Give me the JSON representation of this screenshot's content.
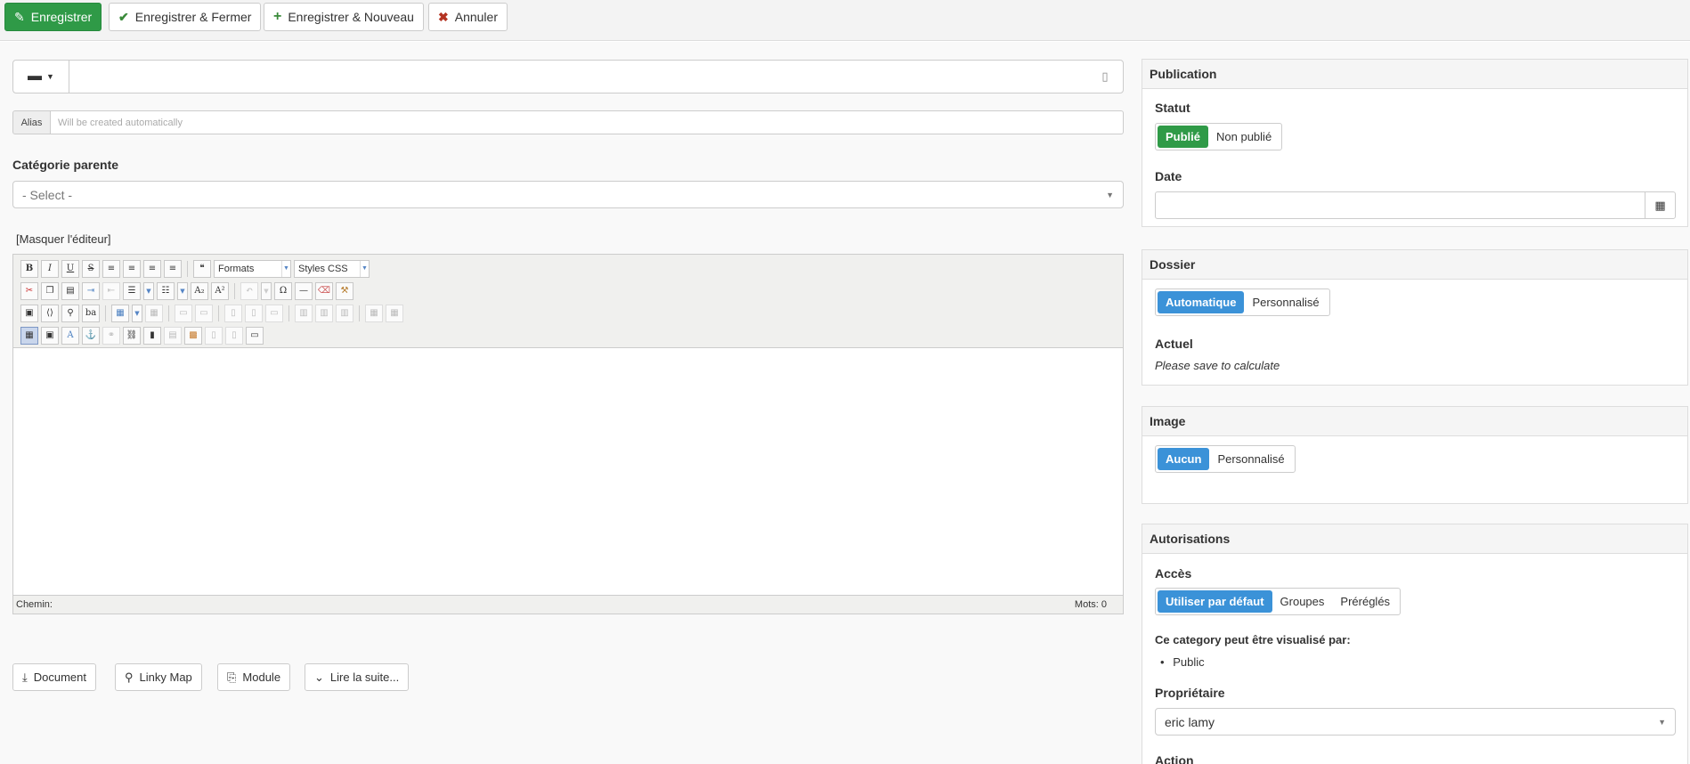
{
  "toolbar": {
    "save": "Enregistrer",
    "save_close": "Enregistrer & Fermer",
    "save_new": "Enregistrer & Nouveau",
    "cancel": "Annuler"
  },
  "form": {
    "title_value": "",
    "alias_label": "Alias",
    "alias_placeholder": "Will be created automatically",
    "parent_label": "Catégorie parente",
    "parent_value": "- Select -",
    "toggle_editor": "[Masquer l'éditeur]"
  },
  "editor": {
    "formats": "Formats",
    "styles": "Styles CSS",
    "path_label": "Chemin:",
    "words_label": "Mots: 0"
  },
  "buttons": {
    "document": "Document",
    "linky_map": "Linky Map",
    "module": "Module",
    "read_more": "Lire la suite..."
  },
  "publication": {
    "title": "Publication",
    "status_label": "Statut",
    "status_options": [
      "Publié",
      "Non publié"
    ],
    "date_label": "Date",
    "date_value": ""
  },
  "dossier": {
    "title": "Dossier",
    "options": [
      "Automatique",
      "Personnalisé"
    ],
    "current_label": "Actuel",
    "current_value": "Please save to calculate"
  },
  "image": {
    "title": "Image",
    "options": [
      "Aucun",
      "Personnalisé"
    ]
  },
  "autorisations": {
    "title": "Autorisations",
    "access_label": "Accès",
    "access_options": [
      "Utiliser par défaut",
      "Groupes",
      "Préréglés"
    ],
    "visible_label": "Ce category peut être visualisé par:",
    "visible_list": [
      "Public"
    ],
    "owner_label": "Propriétaire",
    "owner_value": "eric lamy",
    "action_label": "Action"
  }
}
